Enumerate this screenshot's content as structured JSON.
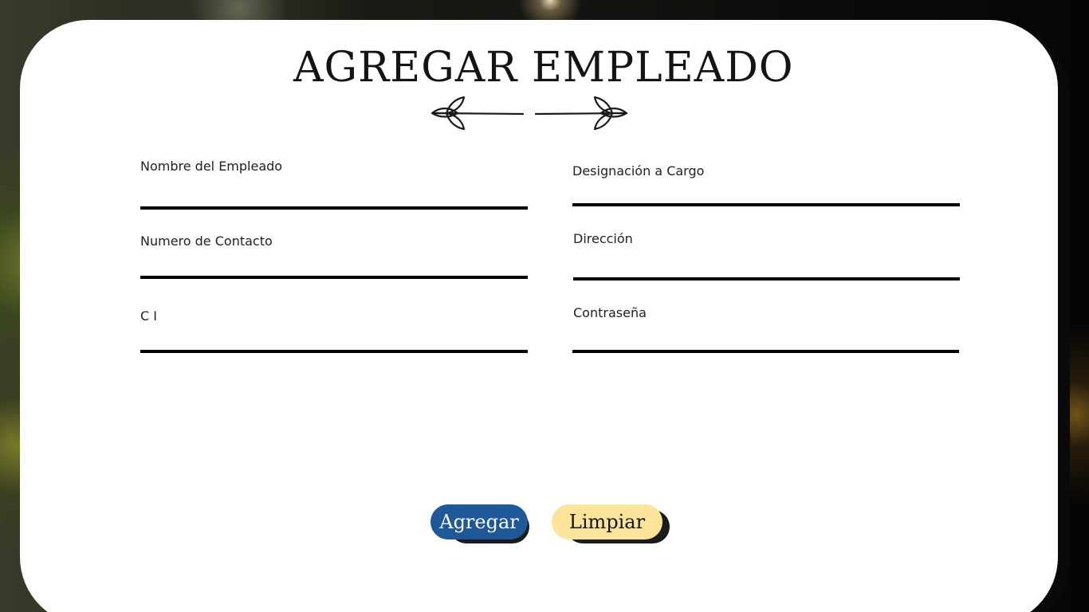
{
  "title": "AGREGAR EMPLEADO",
  "ornament_icon": "leaf-divider-icon",
  "form": {
    "fields": [
      {
        "label": "Nombre del Empleado",
        "value": ""
      },
      {
        "label": "Designación a Cargo",
        "value": ""
      },
      {
        "label": "Numero de Contacto",
        "value": ""
      },
      {
        "label": "Dirección",
        "value": ""
      },
      {
        "label": "C I",
        "value": ""
      },
      {
        "label": "Contraseña",
        "value": ""
      }
    ]
  },
  "buttons": {
    "add_label": "Agregar",
    "clear_label": "Limpiar"
  },
  "colors": {
    "card_background": "#ffffff",
    "add_button": "#1e5899",
    "clear_button": "#fde49b",
    "underline": "#000000"
  }
}
